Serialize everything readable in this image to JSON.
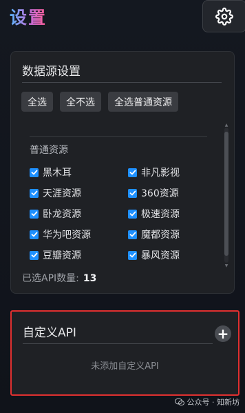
{
  "header": {
    "title": "设置",
    "settings_icon": "gear-icon"
  },
  "data_source_panel": {
    "title": "数据源设置",
    "buttons": {
      "select_all": "全选",
      "select_none": "全不选",
      "select_normal": "全选普通资源"
    },
    "group_title": "普通资源",
    "items": [
      {
        "label": "黑木耳",
        "checked": true
      },
      {
        "label": "非凡影视",
        "checked": true
      },
      {
        "label": "天涯资源",
        "checked": true
      },
      {
        "label": "360资源",
        "checked": true
      },
      {
        "label": "卧龙资源",
        "checked": true
      },
      {
        "label": "极速资源",
        "checked": true
      },
      {
        "label": "华为吧资源",
        "checked": true
      },
      {
        "label": "魔都资源",
        "checked": true
      },
      {
        "label": "豆瓣资源",
        "checked": true
      },
      {
        "label": "暴风资源",
        "checked": true
      }
    ],
    "count_label": "已选API数量:",
    "count_value": "13"
  },
  "custom_api": {
    "title": "自定义API",
    "add_icon": "plus-icon",
    "empty_text": "未添加自定义API"
  },
  "watermark": {
    "text": "公众号 · 知新坊"
  },
  "colors": {
    "accent_blue": "#1e90ff",
    "highlight_red": "#e03030"
  }
}
